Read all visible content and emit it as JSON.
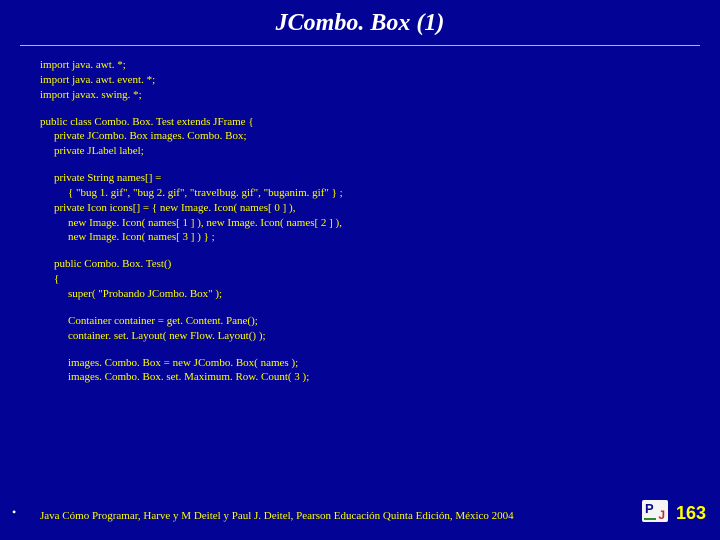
{
  "title": "JCombo. Box (1)",
  "code": {
    "b1l1": "import java. awt. *;",
    "b1l2": "import java. awt. event. *;",
    "b1l3": "import javax. swing. *;",
    "b2l1": "public class Combo. Box. Test extends JFrame {",
    "b2l2": "private JCombo. Box images. Combo. Box;",
    "b2l3": "private JLabel label;",
    "b3l1": "private String names[] =",
    "b3l2": "{ \"bug 1. gif\", \"bug 2. gif\",  \"travelbug. gif\", \"buganim. gif\" } ;",
    "b3l3": "private Icon icons[] = { new Image. Icon( names[ 0 ] ),",
    "b3l4": "new Image. Icon( names[ 1 ] ), new Image. Icon( names[ 2 ] ),",
    "b3l5": "new Image. Icon( names[ 3 ] ) } ;",
    "b4l1": "public Combo. Box. Test()",
    "b4l2": "{",
    "b4l3": "super( \"Probando JCombo. Box\" );",
    "b5l1": "Container container = get. Content. Pane();",
    "b5l2": "container. set. Layout( new Flow. Layout() );",
    "b6l1": "images. Combo. Box = new JCombo. Box( names );",
    "b6l2": "images. Combo. Box. set. Maximum. Row. Count( 3 );"
  },
  "footer": {
    "bullet": "•",
    "text": "Java Cómo Programar, Harve y M Deitel y Paul J. Deitel, Pearson Educación Quinta Edición, México 2004",
    "page": "163"
  },
  "logo": {
    "p": "P",
    "j": "J"
  }
}
